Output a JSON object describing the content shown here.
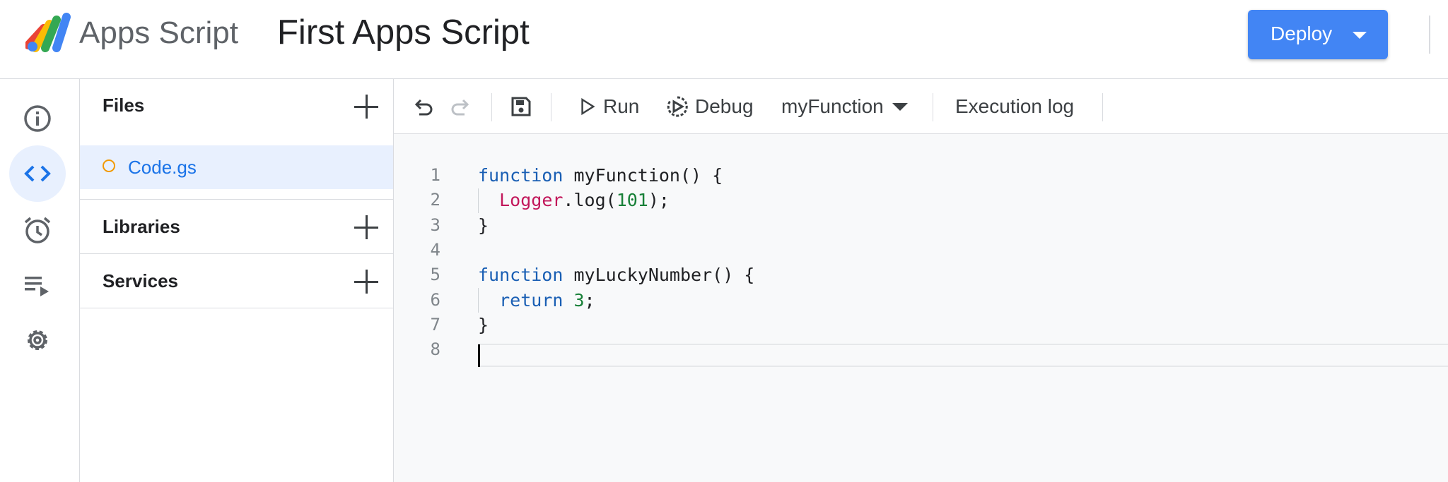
{
  "header": {
    "brand": "Apps Script",
    "project_title": "First Apps Script",
    "deploy_label": "Deploy"
  },
  "rail": {
    "items": [
      {
        "name": "overview",
        "icon": "info-icon",
        "active": false
      },
      {
        "name": "editor",
        "icon": "code-icon",
        "active": true
      },
      {
        "name": "triggers",
        "icon": "alarm-icon",
        "active": false
      },
      {
        "name": "executions",
        "icon": "executions-icon",
        "active": false
      },
      {
        "name": "settings",
        "icon": "gear-icon",
        "active": false
      }
    ]
  },
  "files_panel": {
    "files_title": "Files",
    "files": [
      {
        "name": "Code.gs"
      }
    ],
    "libraries_title": "Libraries",
    "services_title": "Services"
  },
  "toolbar": {
    "run_label": "Run",
    "debug_label": "Debug",
    "function_selected": "myFunction",
    "execution_log_label": "Execution log"
  },
  "editor": {
    "lines": [
      {
        "n": "1",
        "parts": [
          [
            "kw",
            "function"
          ],
          [
            "txt",
            " myFunction() {"
          ]
        ]
      },
      {
        "n": "2",
        "parts": [
          [
            "txt",
            "  "
          ],
          [
            "obj",
            "Logger"
          ],
          [
            "txt",
            ".log("
          ],
          [
            "num",
            "101"
          ],
          [
            "txt",
            ");"
          ]
        ]
      },
      {
        "n": "3",
        "parts": [
          [
            "txt",
            "}"
          ]
        ]
      },
      {
        "n": "4",
        "parts": []
      },
      {
        "n": "5",
        "parts": [
          [
            "kw",
            "function"
          ],
          [
            "txt",
            " myLuckyNumber() {"
          ]
        ]
      },
      {
        "n": "6",
        "parts": [
          [
            "txt",
            "  "
          ],
          [
            "kw",
            "return"
          ],
          [
            "txt",
            " "
          ],
          [
            "num",
            "3"
          ],
          [
            "txt",
            ";"
          ]
        ]
      },
      {
        "n": "7",
        "parts": [
          [
            "txt",
            "}"
          ]
        ]
      },
      {
        "n": "8",
        "parts": []
      }
    ]
  },
  "colors": {
    "accent": "#4285f4",
    "link": "#1a73e8",
    "keyword": "#1a5fb4",
    "object": "#c2185b",
    "number": "#188038"
  }
}
